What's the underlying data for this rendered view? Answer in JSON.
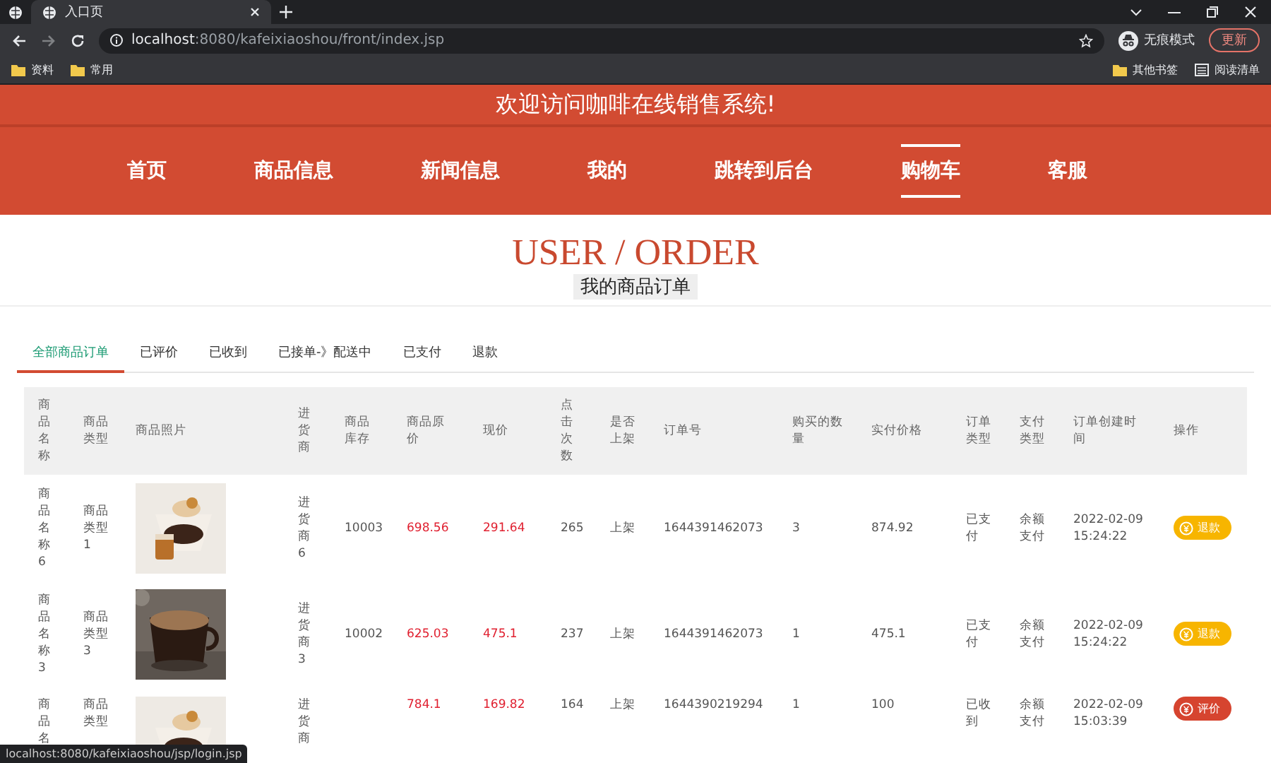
{
  "browser": {
    "tabs": [
      {
        "title": "入口页",
        "selected": true
      }
    ],
    "url_host": "localhost",
    "url_rest": ":8080/kafeixiaoshou/front/index.jsp",
    "profile": "无痕模式",
    "update_button": "更新",
    "bookmarks": [
      "资料",
      "常用"
    ],
    "bookmarks_right": [
      "其他书签",
      "阅读清单"
    ]
  },
  "header": {
    "welcome": "欢迎访问咖啡在线销售系统!"
  },
  "nav": [
    {
      "label": "首页",
      "selected": false
    },
    {
      "label": "商品信息",
      "selected": false
    },
    {
      "label": "新闻信息",
      "selected": false
    },
    {
      "label": "我的",
      "selected": false
    },
    {
      "label": "跳转到后台",
      "selected": false
    },
    {
      "label": "购物车",
      "selected": true
    },
    {
      "label": "客服",
      "selected": false
    }
  ],
  "page": {
    "title": "USER / ORDER",
    "subtitle": "我的商品订单"
  },
  "tabs": [
    {
      "label": "全部商品订单",
      "selected": true
    },
    {
      "label": "已评价",
      "selected": false
    },
    {
      "label": "已收到",
      "selected": false
    },
    {
      "label": "已接单-》配送中",
      "selected": false
    },
    {
      "label": "已支付",
      "selected": false
    },
    {
      "label": "退款",
      "selected": false
    }
  ],
  "table": {
    "columns": [
      "商品名称",
      "商品类型",
      "商品照片",
      "进货商",
      "商品库存",
      "商品原价",
      "现价",
      "点击次数",
      "是否上架",
      "订单号",
      "购买的数量",
      "实付价格",
      "订单类型",
      "支付类型",
      "订单创建时间",
      "操作"
    ],
    "rows": [
      {
        "name": "商品名称6",
        "type": "商品类型1",
        "supplier": "进货商6",
        "stock": "10003",
        "price": "698.56",
        "now_price": "291.64",
        "clicks": "265",
        "shelf": "上架",
        "order_no": "1644391462073",
        "qty": "3",
        "paid": "874.92",
        "order_type": "已支付",
        "pay_type": "余额支付",
        "created": "2022-02-09 15:24:22",
        "action": {
          "label": "退款",
          "kind": "refund"
        }
      },
      {
        "name": "商品名称3",
        "type": "商品类型3",
        "supplier": "进货商3",
        "stock": "10002",
        "price": "625.03",
        "now_price": "475.1",
        "clicks": "237",
        "shelf": "上架",
        "order_no": "1644391462073",
        "qty": "1",
        "paid": "475.1",
        "order_type": "已支付",
        "pay_type": "余额支付",
        "created": "2022-02-09 15:24:22",
        "action": {
          "label": "退款",
          "kind": "refund"
        }
      },
      {
        "name": "商品名",
        "type": "商品类型",
        "supplier": "进货商",
        "price": "784.1",
        "now_price": "169.82",
        "clicks": "164",
        "shelf": "上架",
        "order_no": "1644390219294",
        "qty": "1",
        "paid": "100",
        "order_type": "已收到",
        "pay_type": "余额支付",
        "created": "2022-02-09 15:03:39",
        "action": {
          "label": "评价",
          "kind": "review"
        }
      }
    ]
  },
  "status_url": "localhost:8080/kafeixiaoshou/jsp/login.jsp"
}
